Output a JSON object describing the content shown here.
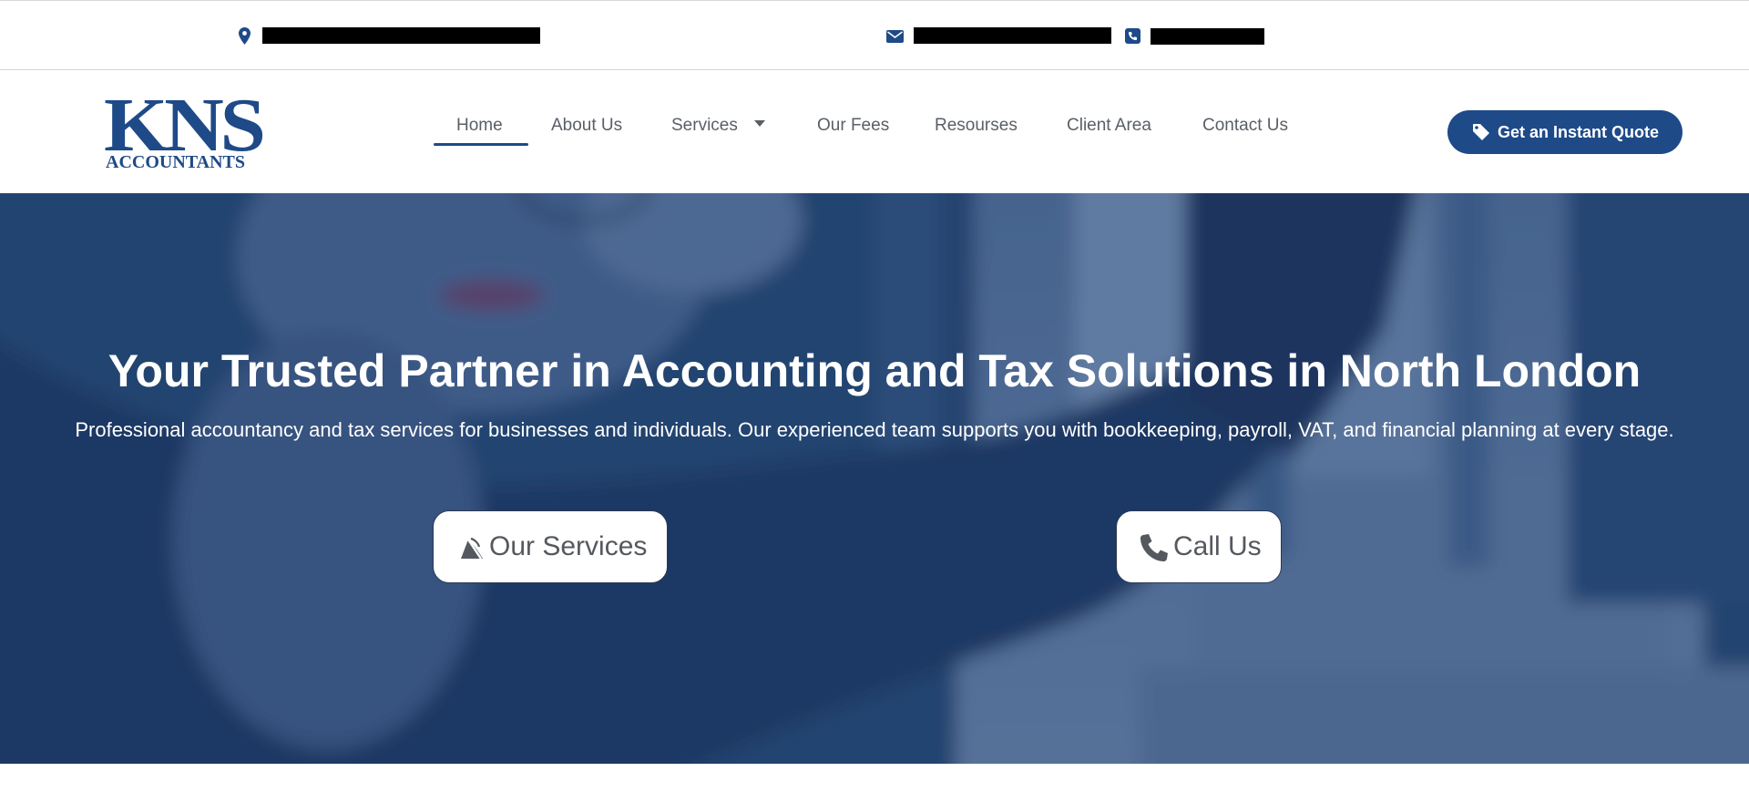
{
  "topbar": {
    "address_text": "",
    "email_text": "",
    "phone_text": ""
  },
  "brand": {
    "logo_main": "KNS",
    "logo_sub": "ACCOUNTANTS",
    "color": "#1e4a88"
  },
  "nav": {
    "items": [
      {
        "label": "Home",
        "active": true
      },
      {
        "label": "About Us"
      },
      {
        "label": "Services",
        "has_dropdown": true
      },
      {
        "label": "Our Fees"
      },
      {
        "label": "Resourses"
      },
      {
        "label": "Client Area"
      },
      {
        "label": "Contact Us"
      }
    ]
  },
  "header": {
    "quote_label": "Get an Instant Quote"
  },
  "hero": {
    "title": "Your Trusted Partner in Accounting and Tax Solutions in North London",
    "subtitle": "Professional accountancy and tax services for businesses and individuals. Our experienced team supports you with bookkeeping, payroll, VAT, and financial planning at every stage.",
    "services_label": "Our Services",
    "call_label": "Call Us"
  },
  "colors": {
    "accent": "#1e4a88",
    "overlay": "#2f4f7c",
    "nav_text": "#5a5f66"
  }
}
